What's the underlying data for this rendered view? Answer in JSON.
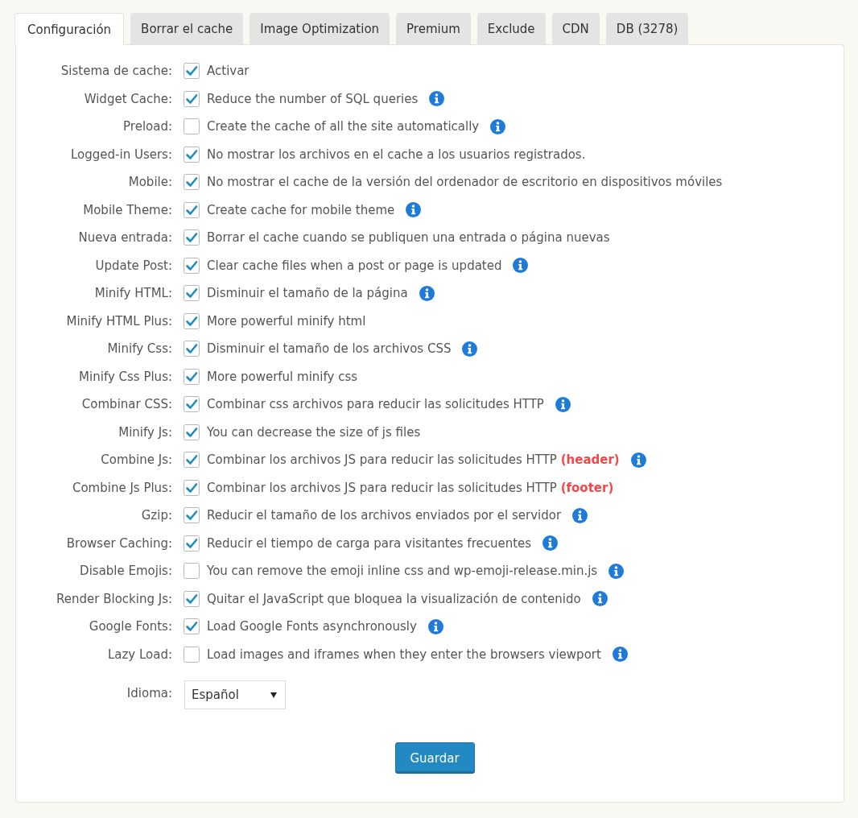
{
  "tabs": [
    {
      "label": "Configuración",
      "selected": true
    },
    {
      "label": "Borrar el cache",
      "selected": false
    },
    {
      "label": "Image Optimization",
      "selected": false
    },
    {
      "label": "Premium",
      "selected": false
    },
    {
      "label": "Exclude",
      "selected": false
    },
    {
      "label": "CDN",
      "selected": false
    },
    {
      "label": "DB (3278)",
      "selected": false
    }
  ],
  "settings": [
    {
      "label": "Sistema de cache:",
      "checked": true,
      "description": "Activar",
      "info": false
    },
    {
      "label": "Widget Cache:",
      "checked": true,
      "description": "Reduce the number of SQL queries",
      "info": true
    },
    {
      "label": "Preload:",
      "checked": false,
      "description": "Create the cache of all the site automatically",
      "info": true
    },
    {
      "label": "Logged-in Users:",
      "checked": true,
      "description": "No mostrar los archivos en el cache a los usuarios registrados.",
      "info": false
    },
    {
      "label": "Mobile:",
      "checked": true,
      "description": "No mostrar el cache de la versión del ordenador de escritorio en dispositivos móviles",
      "info": false
    },
    {
      "label": "Mobile Theme:",
      "checked": true,
      "description": "Create cache for mobile theme",
      "info": true
    },
    {
      "label": "Nueva entrada:",
      "checked": true,
      "description": "Borrar el cache cuando se publiquen una entrada o página nuevas",
      "info": false
    },
    {
      "label": "Update Post:",
      "checked": true,
      "description": "Clear cache files when a post or page is updated",
      "info": true
    },
    {
      "label": "Minify HTML:",
      "checked": true,
      "description": "Disminuir el tamaño de la página",
      "info": true
    },
    {
      "label": "Minify HTML Plus:",
      "checked": true,
      "description": "More powerful minify html",
      "info": false
    },
    {
      "label": "Minify Css:",
      "checked": true,
      "description": "Disminuir el tamaño de los archivos CSS",
      "info": true
    },
    {
      "label": "Minify Css Plus:",
      "checked": true,
      "description": "More powerful minify css",
      "info": false
    },
    {
      "label": "Combinar CSS:",
      "checked": true,
      "description": "Combinar css archivos para reducir las solicitudes HTTP",
      "info": true
    },
    {
      "label": "Minify Js:",
      "checked": true,
      "description": "You can decrease the size of js files",
      "info": false
    },
    {
      "label": "Combine Js:",
      "checked": true,
      "description": "Combinar los archivos JS para reducir las solicitudes HTTP **(header)**",
      "info": true
    },
    {
      "label": "Combine Js Plus:",
      "checked": true,
      "description": "Combinar los archivos JS para reducir las solicitudes HTTP **(footer)**",
      "info": false
    },
    {
      "label": "Gzip:",
      "checked": true,
      "description": "Reducir el tamaño de los archivos enviados por el servidor",
      "info": true
    },
    {
      "label": "Browser Caching:",
      "checked": true,
      "description": "Reducir el tiempo de carga para visitantes frecuentes",
      "info": true
    },
    {
      "label": "Disable Emojis:",
      "checked": false,
      "description": "You can remove the emoji inline css and wp-emoji-release.min.js",
      "info": true
    },
    {
      "label": "Render Blocking Js:",
      "checked": true,
      "description": "Quitar el JavaScript que bloquea la visualización de contenido",
      "info": true
    },
    {
      "label": "Google Fonts:",
      "checked": true,
      "description": "Load Google Fonts asynchronously",
      "info": true
    },
    {
      "label": "Lazy Load:",
      "checked": false,
      "description": "Load images and iframes when they enter the browsers viewport",
      "info": true
    }
  ],
  "language": {
    "label": "Idioma:",
    "value": "Español"
  },
  "save_button": "Guardar"
}
